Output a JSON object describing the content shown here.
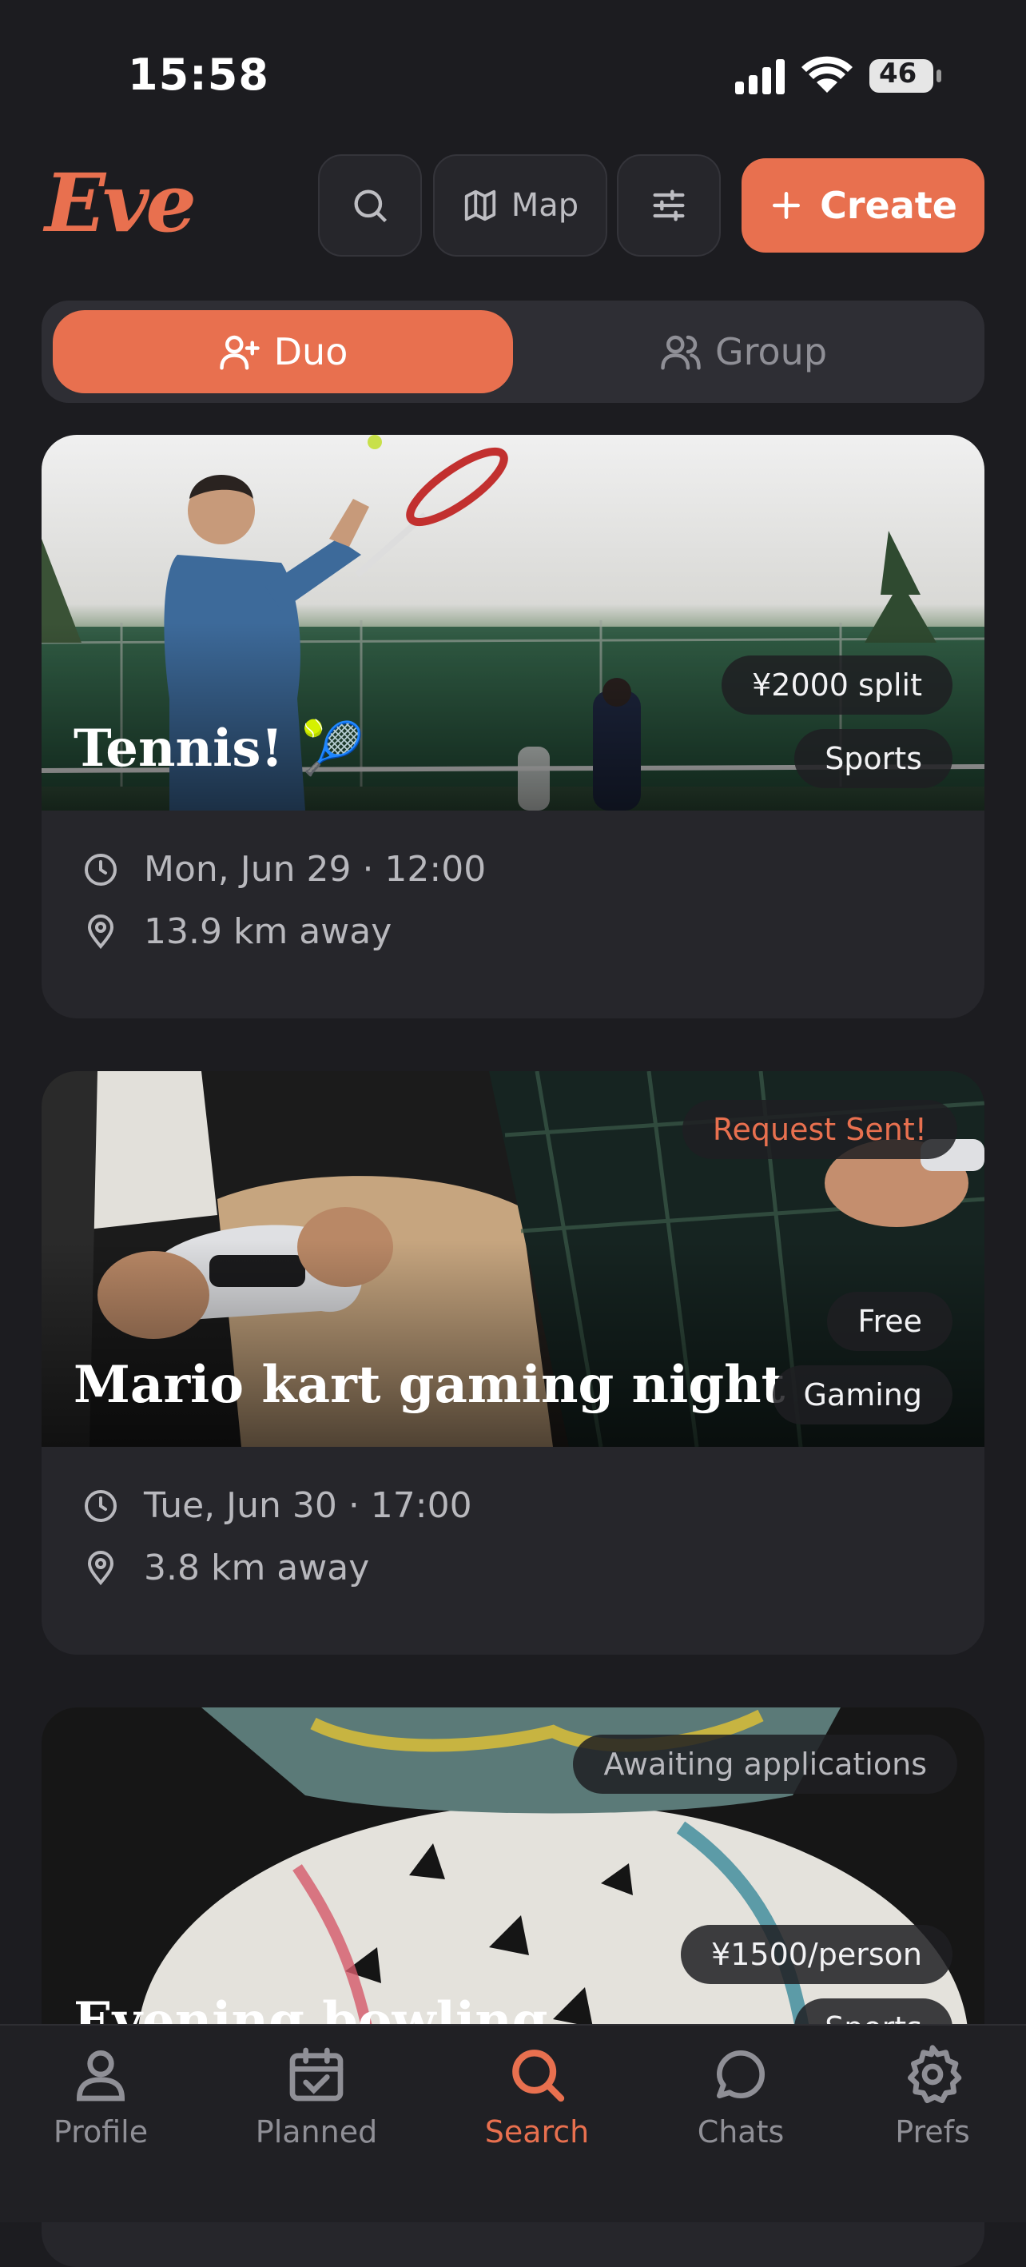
{
  "status_bar": {
    "time": "15:58",
    "battery": "46"
  },
  "header": {
    "logo": "Eve",
    "map_label": "Map",
    "create_label": "Create",
    "accent_color": "#e8704f"
  },
  "mode_toggle": {
    "duo": "Duo",
    "group": "Group",
    "selected": "Duo"
  },
  "events": [
    {
      "title": "Tennis! 🎾",
      "price": "¥2000 split",
      "category": "Sports",
      "date": "Mon, Jun 29 · 12:00",
      "distance": "13.9 km away"
    },
    {
      "title": "Mario kart gaming night",
      "status": "Request Sent!",
      "price": "Free",
      "category": "Gaming",
      "date": "Tue, Jun 30 · 17:00",
      "distance": "3.8 km away"
    },
    {
      "title": "Evening bowling",
      "status": "Awaiting applications",
      "price": "¥1500/person",
      "category": "Sports"
    }
  ],
  "tabs": [
    {
      "label": "Profile",
      "icon": "person-icon"
    },
    {
      "label": "Planned",
      "icon": "calendar-check-icon"
    },
    {
      "label": "Search",
      "icon": "search-icon",
      "active": true
    },
    {
      "label": "Chats",
      "icon": "chat-bubble-icon"
    },
    {
      "label": "Prefs",
      "icon": "gear-icon"
    }
  ]
}
